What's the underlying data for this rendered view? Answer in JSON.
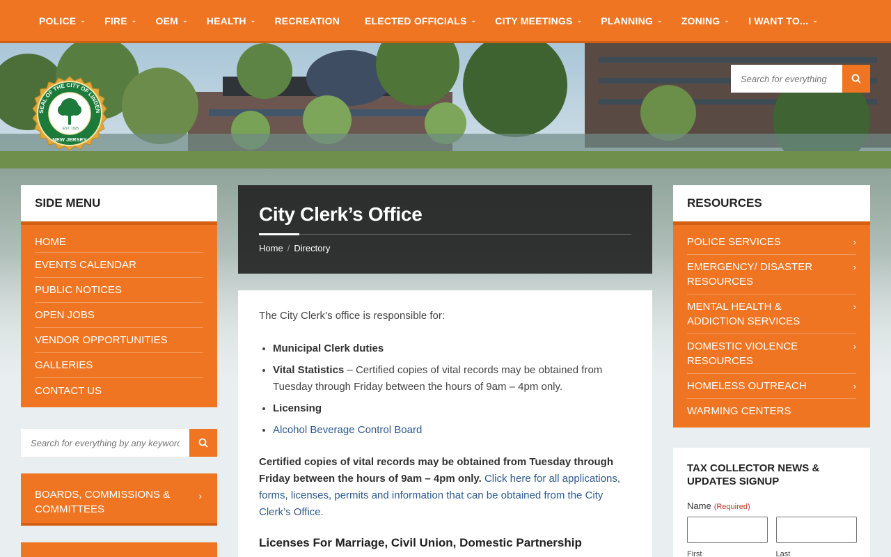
{
  "nav": {
    "items": [
      {
        "label": "POLICE",
        "chevron": true
      },
      {
        "label": "FIRE",
        "chevron": true
      },
      {
        "label": "OEM",
        "chevron": true
      },
      {
        "label": "HEALTH",
        "chevron": true
      },
      {
        "label": "RECREATION",
        "chevron": false
      },
      {
        "label": "ELECTED OFFICIALS",
        "chevron": true
      },
      {
        "label": "CITY MEETINGS",
        "chevron": true
      },
      {
        "label": "PLANNING",
        "chevron": true
      },
      {
        "label": "ZONING",
        "chevron": true
      },
      {
        "label": "I WANT TO...",
        "chevron": true
      }
    ]
  },
  "seal": {
    "ring_text": "SEAL OF THE CITY OF LINDEN",
    "state": "NEW JERSEY",
    "est": "EST.",
    "year": "1925"
  },
  "header_search": {
    "placeholder": "Search for everything"
  },
  "side_menu": {
    "title": "SIDE MENU",
    "items": [
      "HOME",
      "EVENTS CALENDAR",
      "PUBLIC NOTICES",
      "OPEN JOBS",
      "VENDOR OPPORTUNITIES",
      "GALLERIES",
      "CONTACT US"
    ]
  },
  "side_search": {
    "placeholder": "Search for everything by any keyword"
  },
  "boards": {
    "label": "BOARDS, COMMISSIONS & COMMITTEES"
  },
  "page": {
    "title": "City Clerk’s Office",
    "breadcrumb": [
      "Home",
      "Directory"
    ]
  },
  "content": {
    "intro": "The City Clerk’s office is responsible for:",
    "list": {
      "item1": "Municipal Clerk duties",
      "item2_bold": "Vital Statistics",
      "item2_rest": " – Certified copies of vital records may be obtained from Tuesday through Friday between the hours of 9am – 4pm only.",
      "item3": "Licensing",
      "item4_link": "Alcohol Beverage Control Board"
    },
    "para_bold": "Certified copies of vital records may be obtained from Tuesday through Friday between the hours of 9am – 4pm only.",
    "para_link": "Click here for all applications, forms, licenses, permits and information that can be obtained from the City Clerk’s Office.",
    "heading": "Licenses For Marriage, Civil Union, Domestic Partnership"
  },
  "resources": {
    "title": "RESOURCES",
    "items": [
      {
        "label": "POLICE SERVICES",
        "chevron": true
      },
      {
        "label": "EMERGENCY/ DISASTER RESOURCES",
        "chevron": true
      },
      {
        "label": "MENTAL HEALTH & ADDICTION SERVICES",
        "chevron": true
      },
      {
        "label": "DOMESTIC VIOLENCE RESOURCES",
        "chevron": true
      },
      {
        "label": "HOMELESS OUTREACH",
        "chevron": true
      },
      {
        "label": "WARMING CENTERS",
        "chevron": false
      }
    ]
  },
  "signup": {
    "title": "TAX COLLECTOR NEWS & UPDATES SIGNUP",
    "name_label": "Name",
    "required": "(Required)",
    "first": "First",
    "last": "Last"
  },
  "colors": {
    "accent": "#f07522",
    "accent_dark": "#d35f12",
    "title_bg": "#1e1e1e",
    "link": "#2e5a8e"
  }
}
